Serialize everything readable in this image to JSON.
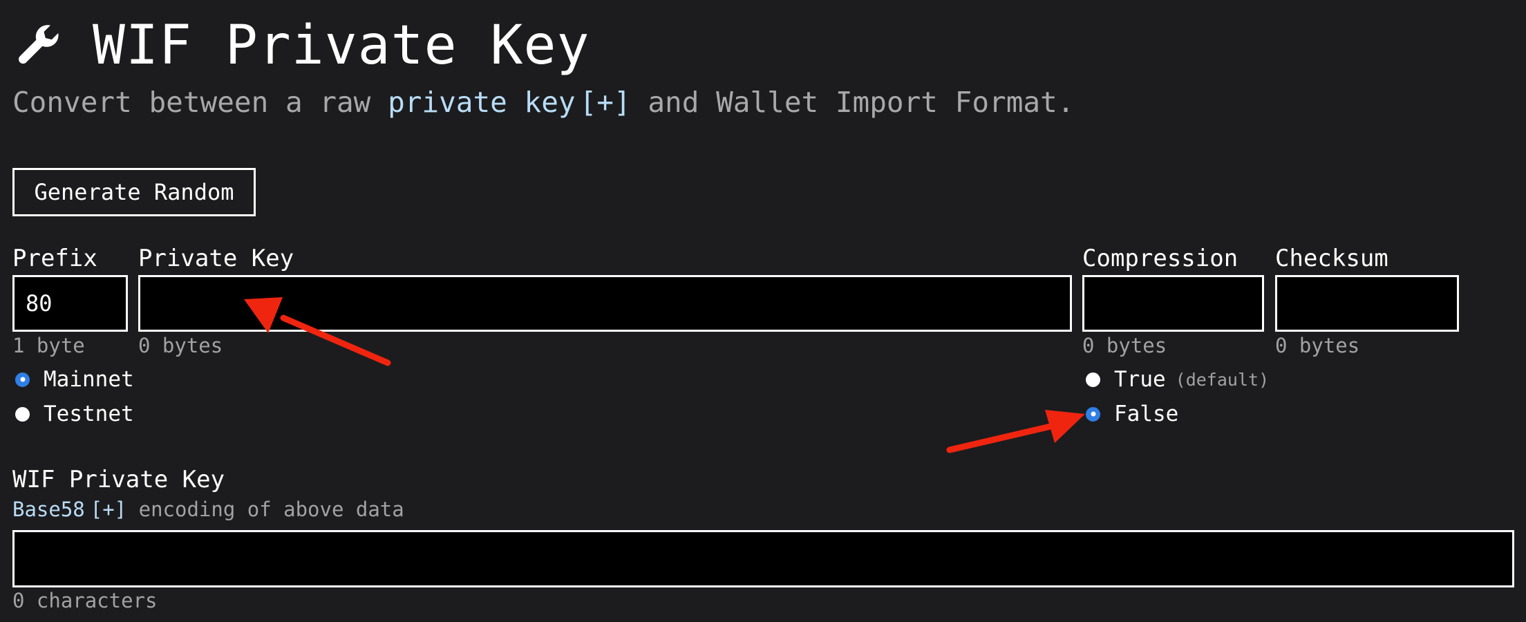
{
  "header": {
    "title": "WIF Private Key",
    "subtitle_prefix": "Convert between a raw ",
    "subtitle_link": "private key",
    "subtitle_expand": "[+]",
    "subtitle_suffix": " and Wallet Import Format."
  },
  "toolbar": {
    "generate_label": "Generate Random"
  },
  "prefix": {
    "label": "Prefix",
    "value": "80",
    "size": "1 byte",
    "options": [
      {
        "label": "Mainnet",
        "checked": true
      },
      {
        "label": "Testnet",
        "checked": false
      }
    ]
  },
  "private_key": {
    "label": "Private Key",
    "value": "",
    "size": "0 bytes"
  },
  "compression": {
    "label": "Compression",
    "value": "",
    "size": "0 bytes",
    "options": [
      {
        "label": "True",
        "hint": "(default)",
        "checked": false
      },
      {
        "label": "False",
        "hint": "",
        "checked": true
      }
    ]
  },
  "checksum": {
    "label": "Checksum",
    "value": "",
    "size": "0 bytes"
  },
  "wif": {
    "label": "WIF Private Key",
    "desc_link": "Base58",
    "desc_expand": "[+]",
    "desc_suffix": " encoding of above data",
    "value": "",
    "count": "0 characters"
  },
  "colors": {
    "background": "#1c1c1e",
    "link": "#b9dcf6",
    "muted": "#a2a2a4",
    "radio_checked": "#2f7fe6",
    "annotation_arrow": "#f0250f"
  },
  "icons": {
    "title_icon": "wrench-icon"
  }
}
